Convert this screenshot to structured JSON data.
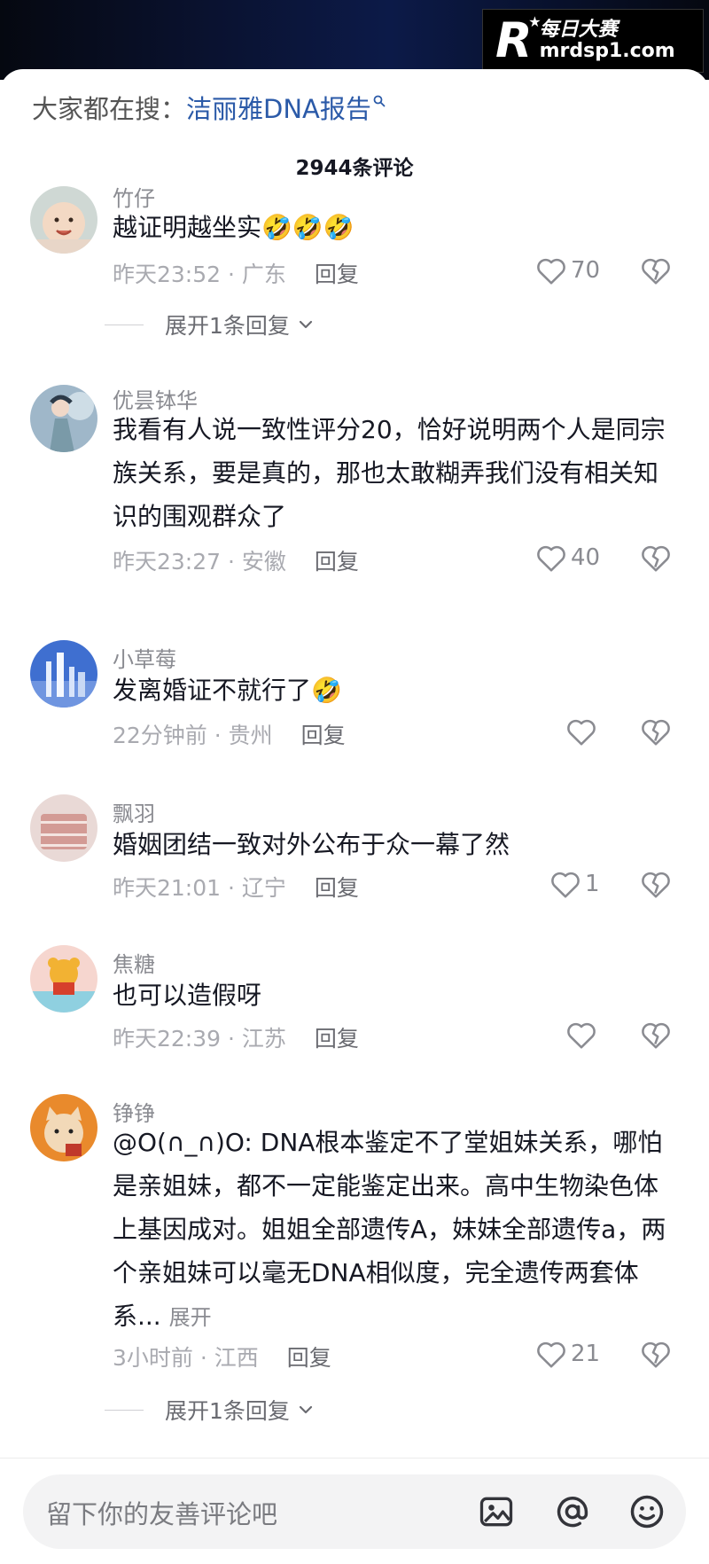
{
  "watermark": {
    "letter": "R",
    "cn": "每日大赛",
    "url": "mrdsp1.com"
  },
  "search_suggest": {
    "label": "大家都在搜：",
    "keyword": "洁丽雅DNA报告"
  },
  "comment_count": "2944条评论",
  "comments": [
    {
      "username": "竹仔",
      "text": "越证明越坐实🤣🤣🤣",
      "time": "昨天23:52",
      "location": "广东",
      "reply": "回复",
      "likes": "70",
      "expand": "展开1条回复"
    },
    {
      "username": "优昙钵华",
      "text": "我看有人说一致性评分20，恰好说明两个人是同宗族关系，要是真的，那也太敢糊弄我们没有相关知识的围观群众了",
      "time": "昨天23:27",
      "location": "安徽",
      "reply": "回复",
      "likes": "40"
    },
    {
      "username": "小草莓",
      "text": "发离婚证不就行了🤣",
      "time": "22分钟前",
      "location": "贵州",
      "reply": "回复",
      "likes": ""
    },
    {
      "username": "飘羽",
      "text": "婚姻团结一致对外公布于众一幕了然",
      "time": "昨天21:01",
      "location": "辽宁",
      "reply": "回复",
      "likes": "1"
    },
    {
      "username": "焦糖",
      "text": "也可以造假呀",
      "time": "昨天22:39",
      "location": "江苏",
      "reply": "回复",
      "likes": ""
    },
    {
      "username": "铮铮",
      "text": "@O(∩_∩)O: DNA根本鉴定不了堂姐妹关系，哪怕是亲姐妹，都不一定能鉴定出来。高中生物染色体上基因成对。姐姐全部遗传A，妹妹全部遗传a，两个亲姐妹可以毫无DNA相似度，完全遗传两套体系...",
      "more": "展开",
      "time": "3小时前",
      "location": "江西",
      "reply": "回复",
      "likes": "21",
      "expand": "展开1条回复"
    }
  ],
  "meta_separator": " · ",
  "input": {
    "placeholder": "留下你的友善评论吧"
  },
  "icons": {
    "like": "heart-outline-icon",
    "dislike": "broken-heart-icon",
    "image": "image-icon",
    "mention": "at-icon",
    "emoji": "emoji-icon",
    "expand": "chevron-down-icon",
    "search": "search-icon"
  },
  "colors": {
    "keyword": "#2b5aa8",
    "meta": "#a9aab0",
    "text": "#161823"
  }
}
